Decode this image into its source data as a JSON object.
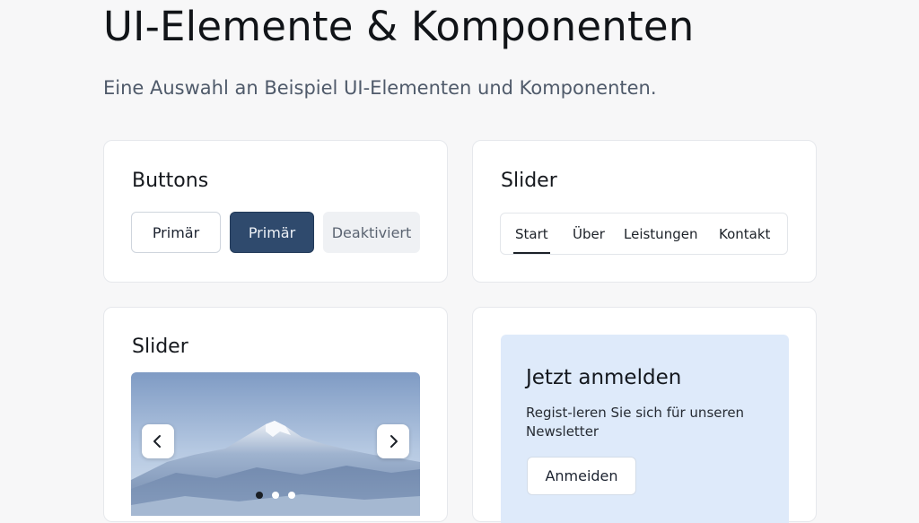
{
  "header": {
    "title": "UI-Elemente & Komponenten",
    "subtitle": "Eine Auswahl an Beispiel UI-Elementen und Komponenten."
  },
  "buttons_card": {
    "title": "Buttons",
    "outline_label": "Primär",
    "primary_label": "Primär",
    "disabled_label": "Deaktiviert"
  },
  "nav_card": {
    "title": "Slider",
    "items": [
      {
        "label": "Start",
        "active": true
      },
      {
        "label": "Über",
        "active": false
      },
      {
        "label": "Leistungen",
        "active": false
      },
      {
        "label": "Kontakt",
        "active": false
      }
    ]
  },
  "slider_card": {
    "title": "Slider",
    "prev_icon": "chevron-left-icon",
    "next_icon": "chevron-right-icon",
    "slide_count": 3,
    "active_slide": 1
  },
  "signup_card": {
    "title": "Jetzt anmelden",
    "text": "Regist-leren Sie sich für unseren Newsletter",
    "button_label": "Anmeiden"
  },
  "colors": {
    "background": "#f7f7f8",
    "primary": "#2f4a6d",
    "signup_panel": "#deeafa"
  }
}
